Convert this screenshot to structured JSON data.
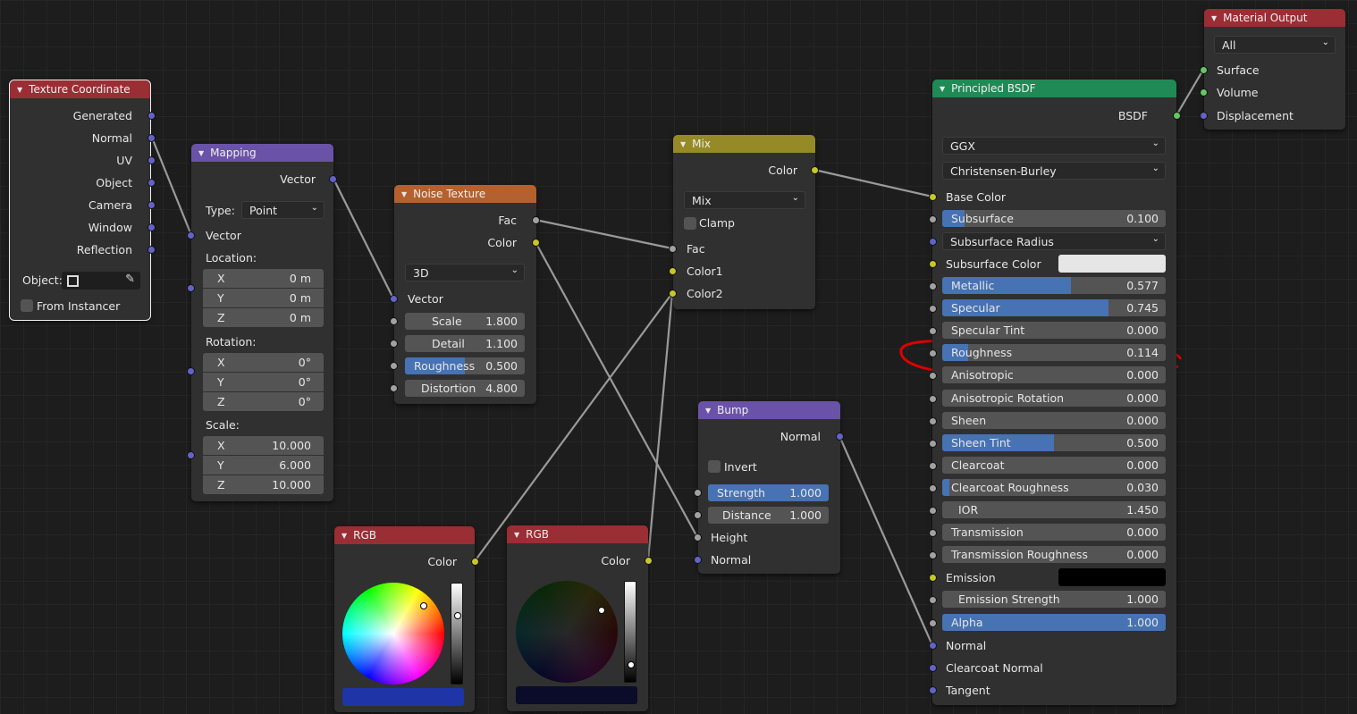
{
  "texcoord": {
    "title": "Texture Coordinate",
    "outputs": [
      "Generated",
      "Normal",
      "UV",
      "Object",
      "Camera",
      "Window",
      "Reflection"
    ],
    "object_label": "Object:",
    "from_instancer": "From Instancer"
  },
  "mapping": {
    "title": "Mapping",
    "output": "Vector",
    "type_label": "Type:",
    "type_value": "Point",
    "input": "Vector",
    "location_label": "Location:",
    "location": [
      {
        "axis": "X",
        "value": "0 m"
      },
      {
        "axis": "Y",
        "value": "0 m"
      },
      {
        "axis": "Z",
        "value": "0 m"
      }
    ],
    "rotation_label": "Rotation:",
    "rotation": [
      {
        "axis": "X",
        "value": "0°"
      },
      {
        "axis": "Y",
        "value": "0°"
      },
      {
        "axis": "Z",
        "value": "0°"
      }
    ],
    "scale_label": "Scale:",
    "scale": [
      {
        "axis": "X",
        "value": "10.000"
      },
      {
        "axis": "Y",
        "value": "6.000"
      },
      {
        "axis": "Z",
        "value": "10.000"
      }
    ]
  },
  "noise": {
    "title": "Noise Texture",
    "out_fac": "Fac",
    "out_color": "Color",
    "dimension": "3D",
    "input": "Vector",
    "fields": [
      {
        "label": "Scale",
        "value": "1.800"
      },
      {
        "label": "Detail",
        "value": "1.100"
      },
      {
        "label": "Roughness",
        "value": "0.500",
        "fill": 0.5
      },
      {
        "label": "Distortion",
        "value": "4.800"
      }
    ]
  },
  "mix": {
    "title": "Mix",
    "output": "Color",
    "blend": "Mix",
    "clamp": "Clamp",
    "inputs": [
      "Fac",
      "Color1",
      "Color2"
    ]
  },
  "bump": {
    "title": "Bump",
    "output": "Normal",
    "invert": "Invert",
    "strength_label": "Strength",
    "strength": "1.000",
    "strength_fill": 1.0,
    "distance_label": "Distance",
    "distance": "1.000",
    "inputs": [
      "Height",
      "Normal"
    ]
  },
  "rgb1": {
    "title": "RGB",
    "output": "Color",
    "color": "#1f34a6"
  },
  "rgb2": {
    "title": "RGB",
    "output": "Color",
    "color": "#0b0b2a"
  },
  "bsdf": {
    "title": "Principled BSDF",
    "output": "BSDF",
    "distribution": "GGX",
    "subsurface_method": "Christensen-Burley",
    "base_color": "Base Color",
    "subsurface": {
      "label": "Subsurface",
      "value": "0.100",
      "fill": 0.1
    },
    "subsurface_radius": "Subsurface Radius",
    "subsurface_color": "Subsurface Color",
    "subsurface_color_hex": "#e6e6e6",
    "params": [
      {
        "label": "Metallic",
        "value": "0.577",
        "fill": 0.577
      },
      {
        "label": "Specular",
        "value": "0.745",
        "fill": 0.745
      },
      {
        "label": "Specular Tint",
        "value": "0.000",
        "fill": 0
      },
      {
        "label": "Roughness",
        "value": "0.114",
        "fill": 0.114
      },
      {
        "label": "Anisotropic",
        "value": "0.000",
        "fill": 0
      },
      {
        "label": "Anisotropic Rotation",
        "value": "0.000",
        "fill": 0
      },
      {
        "label": "Sheen",
        "value": "0.000",
        "fill": 0
      },
      {
        "label": "Sheen Tint",
        "value": "0.500",
        "fill": 0.5
      },
      {
        "label": "Clearcoat",
        "value": "0.000",
        "fill": 0
      },
      {
        "label": "Clearcoat Roughness",
        "value": "0.030",
        "fill": 0.03
      }
    ],
    "ior": {
      "label": "IOR",
      "value": "1.450"
    },
    "transmission": [
      {
        "label": "Transmission",
        "value": "0.000"
      },
      {
        "label": "Transmission Roughness",
        "value": "0.000"
      }
    ],
    "emission": "Emission",
    "emission_hex": "#000000",
    "emission_strength": {
      "label": "Emission Strength",
      "value": "1.000"
    },
    "alpha": {
      "label": "Alpha",
      "value": "1.000",
      "fill": 1.0
    },
    "vectors": [
      "Normal",
      "Clearcoat Normal",
      "Tangent"
    ]
  },
  "output": {
    "title": "Material Output",
    "target": "All",
    "inputs": [
      "Surface",
      "Volume",
      "Displacement"
    ]
  }
}
